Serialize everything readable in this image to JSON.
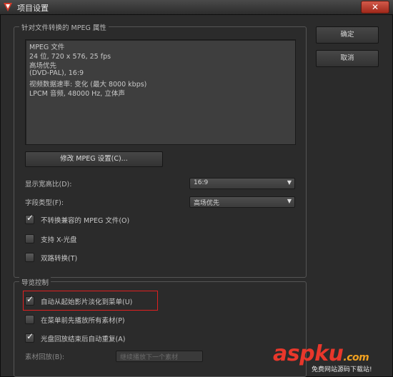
{
  "window": {
    "title": "项目设置",
    "close_label": "✕"
  },
  "buttons": {
    "ok": "确定",
    "cancel": "取消",
    "modify_mpeg": "修改 MPEG 设置(C)..."
  },
  "mpeg_group": {
    "legend": "针对文件转换的 MPEG 属性",
    "info_lines": [
      "MPEG 文件",
      "24 位, 720 x 576, 25 fps",
      "高场优先",
      "(DVD-PAL), 16:9",
      "视频数据速率: 变化 (最大 8000 kbps)",
      "LPCM 音频, 48000 Hz, 立体声"
    ],
    "aspect_label": "显示宽高比(D):",
    "aspect_value": "16:9",
    "field_label": "字段类型(F):",
    "field_value": "高场优先",
    "checkboxes": [
      {
        "label": "不转换兼容的 MPEG 文件(O)",
        "checked": true
      },
      {
        "label": "支持 X-光盘",
        "checked": false
      },
      {
        "label": "双路转换(T)",
        "checked": false
      }
    ]
  },
  "nav_group": {
    "legend": "导览控制",
    "checkboxes": [
      {
        "label": "自动从起始影片淡化到菜单(U)",
        "checked": true
      },
      {
        "label": "在菜单前先播放所有素材(P)",
        "checked": false
      },
      {
        "label": "光盘回放结束后自动重复(A)",
        "checked": true
      }
    ],
    "playback_label": "素材回放(B):",
    "playback_value": "继续播放下一个素材"
  },
  "watermark": {
    "brand_a": "asp",
    "brand_b": "ku",
    "brand_tld": ".com",
    "tagline": "免费网站源码下载站!"
  },
  "colors": {
    "accent_red": "#e02020",
    "brand_red": "#e8372b"
  }
}
